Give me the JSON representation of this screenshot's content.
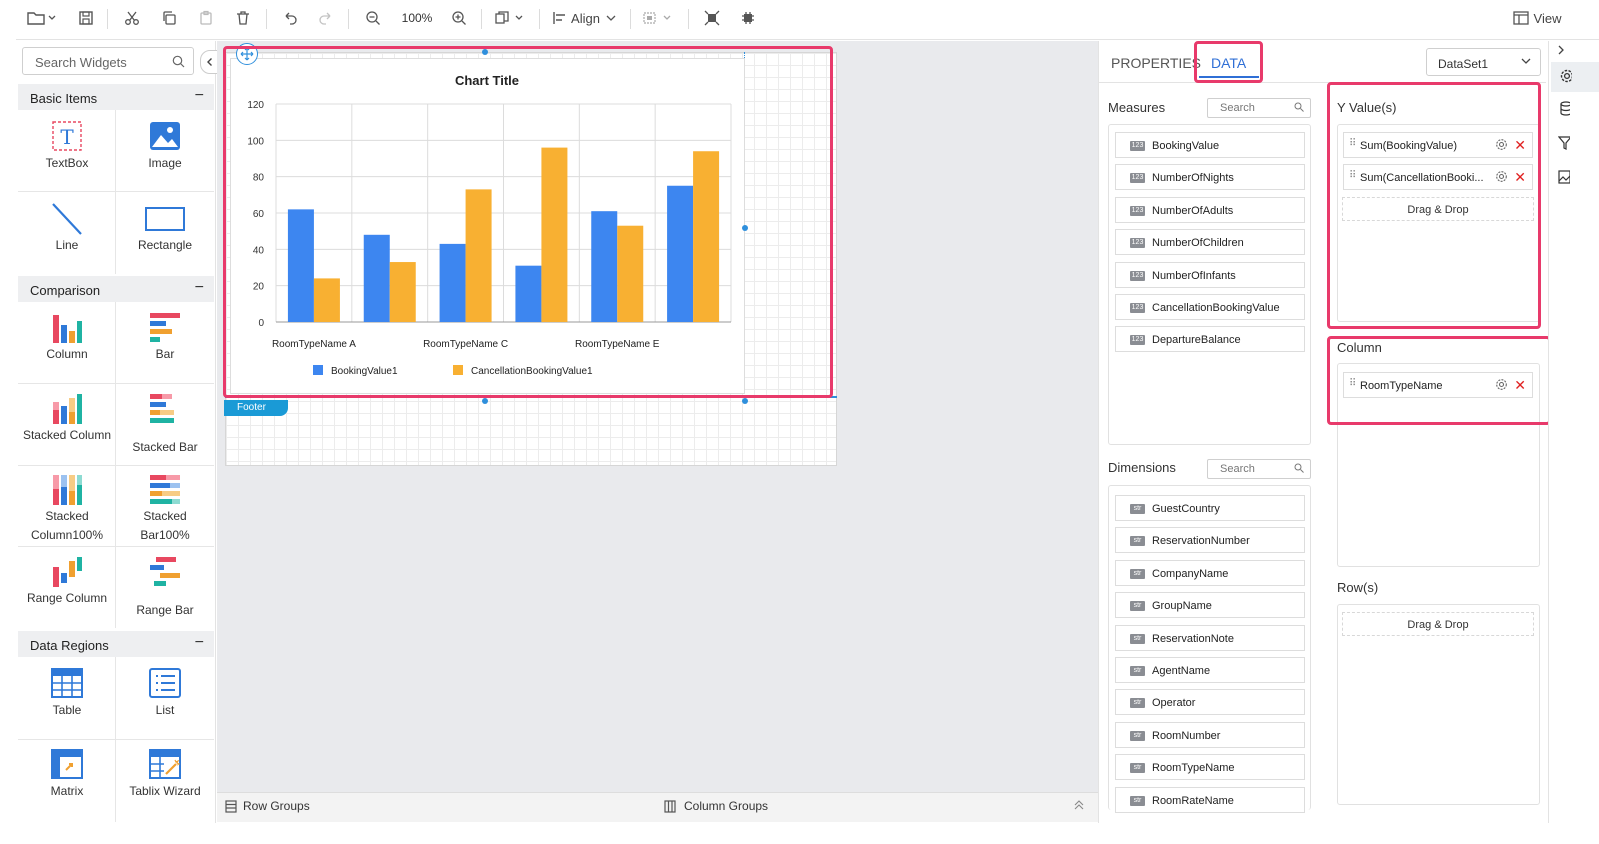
{
  "toolbar": {
    "zoom": "100%",
    "align_label": "Align",
    "view_label": "View"
  },
  "left": {
    "search_placeholder": "Search Widgets",
    "sections": [
      {
        "title": "Basic Items",
        "items": [
          "TextBox",
          "Image",
          "Line",
          "Rectangle"
        ]
      },
      {
        "title": "Comparison",
        "items": [
          "Column",
          "Bar",
          "Stacked Column",
          "Stacked Bar",
          "Stacked Column100%",
          "Stacked Bar100%",
          "Range Column",
          "Range Bar"
        ]
      },
      {
        "title": "Data Regions",
        "items": [
          "Table",
          "List",
          "Matrix",
          "Tablix Wizard"
        ]
      }
    ]
  },
  "canvas": {
    "footer_label": "Footer",
    "row_groups": "Row Groups",
    "column_groups": "Column Groups"
  },
  "chart_data": {
    "type": "bar",
    "title": "Chart Title",
    "categories": [
      "RoomTypeName A",
      "",
      "RoomTypeName C",
      "",
      "RoomTypeName E",
      ""
    ],
    "series": [
      {
        "name": "BookingValue1",
        "color": "#3d86f0",
        "values": [
          62,
          48,
          43,
          31,
          61,
          75
        ]
      },
      {
        "name": "CancellationBookingValue1",
        "color": "#f8b032",
        "values": [
          24,
          33,
          73,
          96,
          53,
          94
        ]
      }
    ],
    "yticks": [
      "0",
      "20",
      "40",
      "60",
      "80",
      "100",
      "120"
    ],
    "ylim": [
      0,
      120
    ],
    "grid": true,
    "legend": "bottom"
  },
  "right": {
    "tabs": [
      "PROPERTIES",
      "DATA"
    ],
    "dataset": "DataSet1",
    "measures_label": "Measures",
    "dimensions_label": "Dimensions",
    "search": "Search",
    "measures": [
      "BookingValue",
      "NumberOfNights",
      "NumberOfAdults",
      "NumberOfChildren",
      "NumberOfInfants",
      "CancellationBookingValue",
      "DepartureBalance"
    ],
    "dimensions": [
      "GuestCountry",
      "ReservationNumber",
      "CompanyName",
      "GroupName",
      "ReservationNote",
      "AgentName",
      "Operator",
      "RoomNumber",
      "RoomTypeName",
      "RoomRateName"
    ],
    "measure_badge": "123",
    "dimension_badge": "str",
    "yvalues_label": "Y Value(s)",
    "yvalues": [
      "Sum(BookingValue)",
      "Sum(CancellationBooki..."
    ],
    "column_label": "Column",
    "column_items": [
      "RoomTypeName"
    ],
    "rows_label": "Row(s)",
    "drag_drop": "Drag & Drop"
  }
}
